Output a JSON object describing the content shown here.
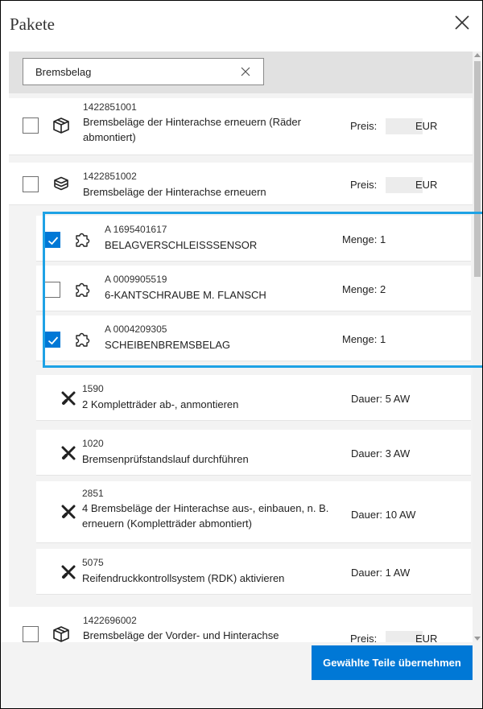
{
  "dialog": {
    "title": "Pakete"
  },
  "search": {
    "value": "Bremsbelag"
  },
  "packages": [
    {
      "number": "1422851001",
      "description": "Bremsbeläge der Hinterachse erneuern (Räder abmontiert)",
      "price_label": "Preis:",
      "currency": "EUR",
      "checked": false,
      "icon": "box-icon"
    },
    {
      "number": "1422851002",
      "description": "Bremsbeläge der Hinterachse erneuern",
      "price_label": "Preis:",
      "currency": "EUR",
      "checked": false,
      "icon": "box-stack-icon"
    },
    {
      "number": "1422696002",
      "description": "Bremsbeläge der Vorder- und Hinterachse erneuern, Festsattel",
      "price_label": "Preis:",
      "currency": "EUR",
      "checked": false,
      "icon": "box-icon"
    }
  ],
  "parts": [
    {
      "number": "A 1695401617",
      "description": "BELAGVERSCHLEISSSENSOR",
      "quantity": "Menge: 1",
      "checked": true,
      "icon": "puzzle-icon"
    },
    {
      "number": "A 0009905519",
      "description": "6-KANTSCHRAUBE M. FLANSCH",
      "quantity": "Menge: 2",
      "checked": false,
      "icon": "puzzle-icon"
    },
    {
      "number": "A 0004209305",
      "description": "SCHEIBENBREMSBELAG",
      "quantity": "Menge: 1",
      "checked": true,
      "icon": "puzzle-icon"
    }
  ],
  "labor": [
    {
      "number": "1590",
      "description": "2 Kompletträder ab-, anmontieren",
      "duration": "Dauer: 5 AW",
      "icon": "tools-icon"
    },
    {
      "number": "1020",
      "description": "Bremsenprüfstandslauf durchführen",
      "duration": "Dauer: 3 AW",
      "icon": "tools-icon"
    },
    {
      "number": "2851",
      "description": "4 Bremsbeläge der Hinterachse aus-, einbauen, n. B. erneuern (Kompletträder abmontiert)",
      "duration": "Dauer: 10 AW",
      "icon": "tools-icon"
    },
    {
      "number": "5075",
      "description": "Reifendruckkontrollsystem (RDK) aktivieren",
      "duration": "Dauer: 1 AW",
      "icon": "tools-icon"
    }
  ],
  "footer": {
    "apply_label": "Gewählte Teile übernehmen"
  },
  "colors": {
    "accent": "#0078d6",
    "highlight": "#1ea2e5"
  }
}
